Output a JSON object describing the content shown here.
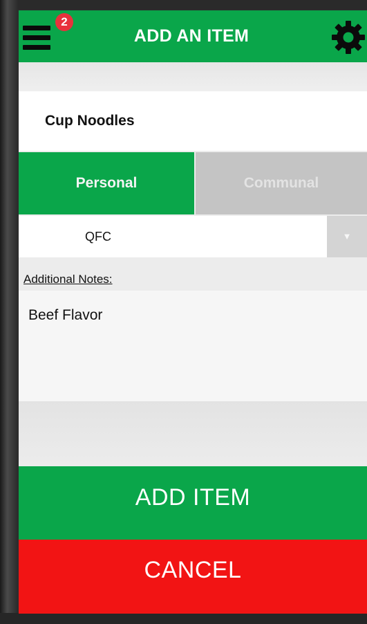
{
  "header": {
    "title": "ADD AN ITEM",
    "badge_count": "2",
    "menu_icon": "hamburger-menu-icon",
    "settings_icon": "gear-icon"
  },
  "form": {
    "item_name": "Cup Noodles",
    "segments": {
      "personal": "Personal",
      "communal": "Communal",
      "selected": "Personal"
    },
    "store_select": {
      "value": "QFC",
      "arrow_icon": "dropdown-triangle-icon"
    },
    "notes_label": "Additional Notes:",
    "notes_value": "Beef Flavor"
  },
  "actions": {
    "add_label": "ADD ITEM",
    "cancel_label": "CANCEL"
  },
  "colors": {
    "accent_green": "#0aa64a",
    "cancel_red": "#f21414",
    "badge_red": "#e8323c",
    "inactive_gray": "#c4c4c4"
  }
}
